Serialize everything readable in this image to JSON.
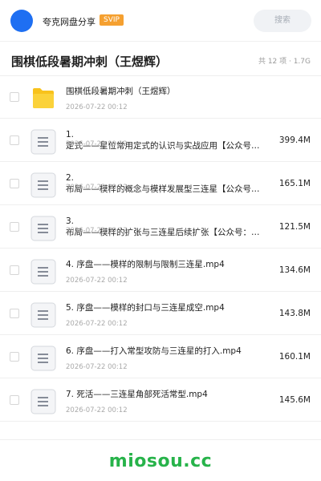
{
  "header": {
    "share_name": "夸克网盘分享",
    "vip_label": "SVIP",
    "search_placeholder": "搜索",
    "avatar_color": "#1e6ff2",
    "vip_color": "#f5a030"
  },
  "folder": {
    "title": "围棋低段暑期冲刺（王煜辉）",
    "meta": "共 12 项 · 1.7G"
  },
  "files": [
    {
      "type": "folder",
      "name": "围棋低段暑期冲刺（王煜辉）",
      "time": "2026-07-22 00:12",
      "size": ""
    },
    {
      "type": "file",
      "name": "1.\n定式——星位常用定式的认识与实战应用【公众号…",
      "time": "2026-07-22 00:12",
      "size": "399.4M"
    },
    {
      "type": "file",
      "name": "2.\n布局——模样的概念与模样发展型三连星【公众号…",
      "time": "2026-07-22 00:12",
      "size": "165.1M"
    },
    {
      "type": "file",
      "name": "3.\n布局——模样的扩张与三连星后续扩张【公众号：…",
      "time": "2026-07-22 00:12",
      "size": "121.5M"
    },
    {
      "type": "file",
      "name": "4. 序盘——模样的限制与限制三连星.mp4",
      "time": "2026-07-22 00:12",
      "size": "134.6M"
    },
    {
      "type": "file",
      "name": "5. 序盘——模样的封口与三连星成空.mp4",
      "time": "2026-07-22 00:12",
      "size": "143.8M"
    },
    {
      "type": "file",
      "name": "6. 序盘——打入常型攻防与三连星的打入.mp4",
      "time": "2026-07-22 00:12",
      "size": "160.1M"
    },
    {
      "type": "file",
      "name": "7. 死活——三连星角部死活常型.mp4",
      "time": "2026-07-22 00:12",
      "size": "145.6M"
    }
  ],
  "watermark": "miosou.cc",
  "colors": {
    "folder_icon": "#f8c21c",
    "watermark": "#27b34a"
  }
}
